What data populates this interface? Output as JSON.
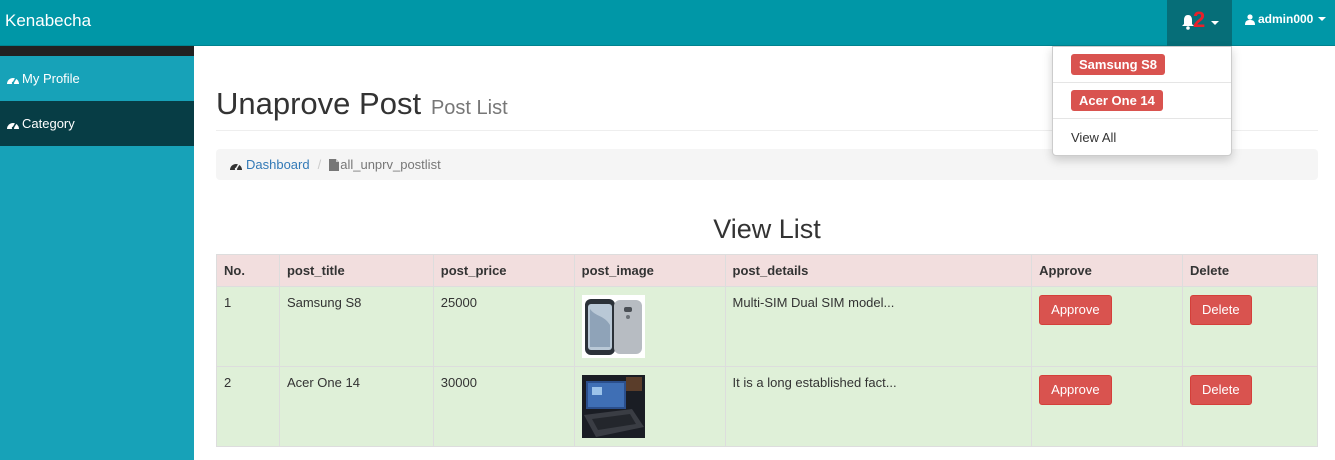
{
  "app": {
    "brand": "Kenabecha"
  },
  "navbar": {
    "notification_count": "2",
    "user_label": "admin000"
  },
  "sidebar": {
    "items": [
      {
        "label": "My Profile",
        "icon": "dashboard-icon"
      },
      {
        "label": "Category",
        "icon": "dashboard-icon"
      }
    ]
  },
  "header": {
    "title": "Unaprove Post",
    "subtitle": "Post List"
  },
  "breadcrumb": {
    "home": "Dashboard",
    "current": "all_unprv_postlist"
  },
  "list": {
    "title": "View List",
    "columns": [
      "No.",
      "post_title",
      "post_price",
      "post_image",
      "post_details",
      "Approve",
      "Delete"
    ],
    "rows": [
      {
        "no": "1",
        "title": "Samsung S8",
        "price": "25000",
        "image": "phone-image",
        "details": "Multi-SIM Dual SIM model...",
        "approve": "Approve",
        "delete": "Delete"
      },
      {
        "no": "2",
        "title": "Acer One 14",
        "price": "30000",
        "image": "laptop-image",
        "details": "It is a long established fact...",
        "approve": "Approve",
        "delete": "Delete"
      }
    ]
  },
  "notifications": {
    "items": [
      "Samsung S8",
      "Acer One 14"
    ],
    "view_all": "View All"
  },
  "colors": {
    "navbar": "#0097a7",
    "sidebar": "#17a2b8",
    "sidebar_active": "#073d45",
    "danger": "#d9534f",
    "table_head": "#f2dede",
    "table_row": "#dff0d8"
  }
}
